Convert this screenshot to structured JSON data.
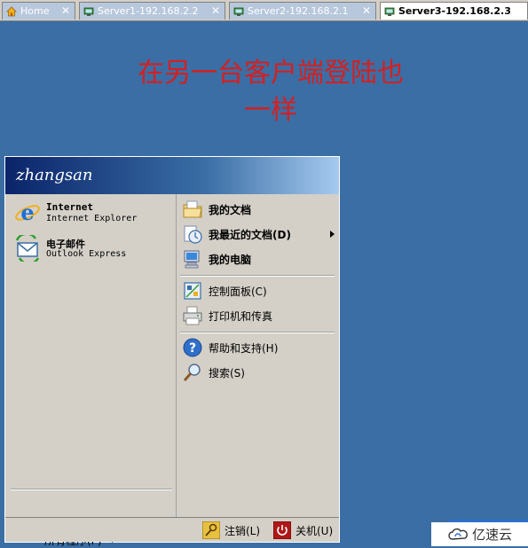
{
  "tabs": [
    {
      "label": "Home",
      "icon": "home-icon",
      "active": false
    },
    {
      "label": "Server1-192.168.2.2",
      "icon": "server-icon",
      "active": false
    },
    {
      "label": "Server2-192.168.2.1",
      "icon": "server-icon",
      "active": false
    },
    {
      "label": "Server3-192.168.2.3",
      "icon": "server-icon",
      "active": true
    }
  ],
  "desktop": {
    "message_line1": "在另一台客户端登陆也",
    "message_line2": "一样",
    "background_color": "#3a6ea5",
    "message_color": "#d42020"
  },
  "start_menu": {
    "username": "zhangsan",
    "pinned": [
      {
        "title": "Internet",
        "subtitle": "Internet Explorer",
        "icon": "internet-explorer-icon"
      },
      {
        "title": "电子邮件",
        "subtitle": "Outlook Express",
        "icon": "outlook-express-icon"
      }
    ],
    "all_programs": "所有程序(P)",
    "places": [
      {
        "label": "我的文档",
        "icon": "my-documents-icon",
        "bold": true
      },
      {
        "label": "我最近的文档(D)",
        "icon": "recent-documents-icon",
        "bold": true,
        "submenu": true
      },
      {
        "label": "我的电脑",
        "icon": "my-computer-icon",
        "bold": true
      },
      {
        "label": "控制面板(C)",
        "icon": "control-panel-icon",
        "bold": false
      },
      {
        "label": "打印机和传真",
        "icon": "printers-icon",
        "bold": false
      },
      {
        "label": "帮助和支持(H)",
        "icon": "help-icon",
        "bold": false
      },
      {
        "label": "搜索(S)",
        "icon": "search-icon",
        "bold": false
      }
    ],
    "footer": {
      "logoff": "注销(L)",
      "shutdown": "关机(U)"
    }
  },
  "watermark": {
    "text": "亿速云",
    "icon": "cloud-logo-icon"
  }
}
